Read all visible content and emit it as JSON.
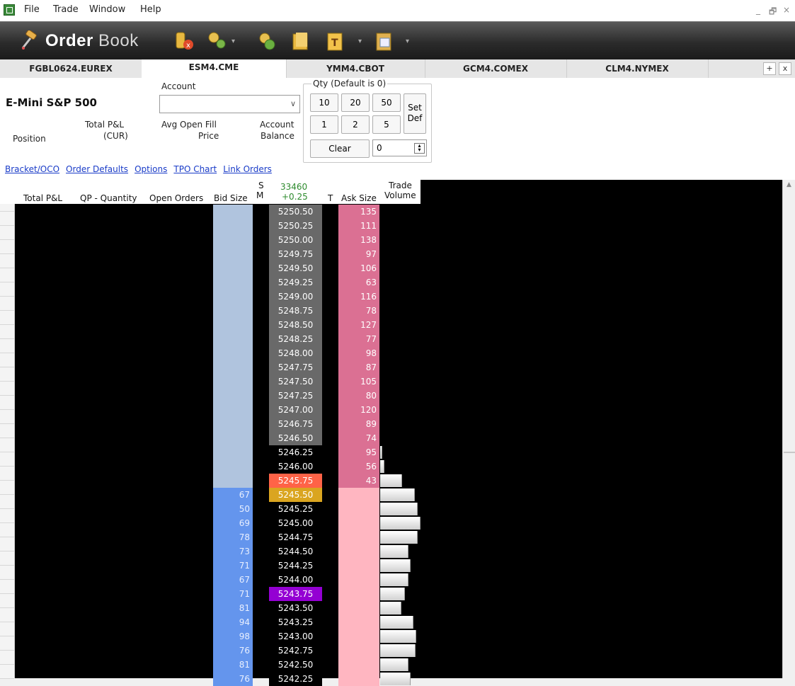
{
  "menubar": {
    "items": [
      "File",
      "Trade",
      "Window",
      "Help"
    ],
    "controls": {
      "minimize": "_",
      "restore": "🗗",
      "close": "×"
    }
  },
  "banner": {
    "logo_bold": "Order",
    "logo_light": "Book",
    "toolbar_icons": [
      "cancel-orders-icon",
      "gears-icon",
      "recycle-gears-icon",
      "folder-icon",
      "template-icon",
      "clipboard-icon"
    ]
  },
  "tabs": {
    "items": [
      {
        "label": "FGBL0624.EUREX",
        "active": false
      },
      {
        "label": "ESM4.CME",
        "active": true
      },
      {
        "label": "YMM4.CBOT",
        "active": false
      },
      {
        "label": "GCM4.COMEX",
        "active": false
      },
      {
        "label": "CLM4.NYMEX",
        "active": false
      }
    ],
    "add_label": "+",
    "close_label": "x"
  },
  "panel": {
    "instrument": "E-Mini S&P 500",
    "account_label": "Account",
    "account_value": "",
    "position_label": "Position",
    "total_pnl_label_1": "Total P&L",
    "total_pnl_label_2": "(CUR)",
    "avg_open_label_1": "Avg Open Fill",
    "avg_open_label_2": "Price",
    "acct_balance_label_1": "Account",
    "acct_balance_label_2": "Balance",
    "qty_legend": "Qty (Default is 0)",
    "qty_row1": [
      "10",
      "20",
      "50"
    ],
    "qty_row2": [
      "1",
      "2",
      "5"
    ],
    "set_def_label_1": "Set",
    "set_def_label_2": "Def",
    "clear_label": "Clear",
    "qty_value": "0"
  },
  "links": [
    "Bracket/OCO",
    "Order Defaults",
    "Options",
    "TPO Chart",
    "Link Orders"
  ],
  "ladder_header": {
    "total_pnl": "Total P&L",
    "qp_quantity": "QP - Quantity",
    "open_orders": "Open Orders",
    "bid_size": "Bid Size",
    "s": "S",
    "m": "M",
    "volume_top": "33460",
    "change": "+0.25",
    "t": "T",
    "ask_size": "Ask Size",
    "trade": "Trade",
    "volume": "Volume"
  },
  "colors": {
    "bid_light": "#b0c4de",
    "bid": "#6495ed",
    "ask": "#db7093",
    "ask_light": "#ffb6c1",
    "price_gray": "#696969",
    "last_trade": "#ff6347",
    "best_bid": "#daa520",
    "highlight": "#9400d3",
    "change_green": "#4cbb17"
  },
  "ladder": [
    {
      "price": "5250.50",
      "ask": "135",
      "bid": "",
      "vol": 0,
      "style": "gray"
    },
    {
      "price": "5250.25",
      "ask": "111",
      "bid": "",
      "vol": 0,
      "style": "gray"
    },
    {
      "price": "5250.00",
      "ask": "138",
      "bid": "",
      "vol": 0,
      "style": "gray"
    },
    {
      "price": "5249.75",
      "ask": "97",
      "bid": "",
      "vol": 0,
      "style": "gray"
    },
    {
      "price": "5249.50",
      "ask": "106",
      "bid": "",
      "vol": 0,
      "style": "gray"
    },
    {
      "price": "5249.25",
      "ask": "63",
      "bid": "",
      "vol": 0,
      "style": "gray"
    },
    {
      "price": "5249.00",
      "ask": "116",
      "bid": "",
      "vol": 0,
      "style": "gray"
    },
    {
      "price": "5248.75",
      "ask": "78",
      "bid": "",
      "vol": 0,
      "style": "gray"
    },
    {
      "price": "5248.50",
      "ask": "127",
      "bid": "",
      "vol": 0,
      "style": "gray"
    },
    {
      "price": "5248.25",
      "ask": "77",
      "bid": "",
      "vol": 0,
      "style": "gray"
    },
    {
      "price": "5248.00",
      "ask": "98",
      "bid": "",
      "vol": 0,
      "style": "gray"
    },
    {
      "price": "5247.75",
      "ask": "87",
      "bid": "",
      "vol": 0,
      "style": "gray"
    },
    {
      "price": "5247.50",
      "ask": "105",
      "bid": "",
      "vol": 0,
      "style": "gray"
    },
    {
      "price": "5247.25",
      "ask": "80",
      "bid": "",
      "vol": 0,
      "style": "gray"
    },
    {
      "price": "5247.00",
      "ask": "120",
      "bid": "",
      "vol": 0,
      "style": "gray"
    },
    {
      "price": "5246.75",
      "ask": "89",
      "bid": "",
      "vol": 0,
      "style": "gray"
    },
    {
      "price": "5246.50",
      "ask": "74",
      "bid": "",
      "vol": 0,
      "style": "gray"
    },
    {
      "price": "5246.25",
      "ask": "95",
      "bid": "",
      "vol": 0.04,
      "style": "black"
    },
    {
      "price": "5246.00",
      "ask": "56",
      "bid": "",
      "vol": 0.09,
      "style": "black"
    },
    {
      "price": "5245.75",
      "ask": "43",
      "bid": "",
      "vol": 0.5,
      "style": "last"
    },
    {
      "price": "5245.50",
      "ask": "",
      "bid": "67",
      "vol": 0.8,
      "style": "bestbid"
    },
    {
      "price": "5245.25",
      "ask": "",
      "bid": "50",
      "vol": 0.87,
      "style": "black"
    },
    {
      "price": "5245.00",
      "ask": "",
      "bid": "69",
      "vol": 0.93,
      "style": "black"
    },
    {
      "price": "5244.75",
      "ask": "",
      "bid": "78",
      "vol": 0.87,
      "style": "black"
    },
    {
      "price": "5244.50",
      "ask": "",
      "bid": "73",
      "vol": 0.65,
      "style": "black"
    },
    {
      "price": "5244.25",
      "ask": "",
      "bid": "71",
      "vol": 0.7,
      "style": "black"
    },
    {
      "price": "5244.00",
      "ask": "",
      "bid": "67",
      "vol": 0.65,
      "style": "black"
    },
    {
      "price": "5243.75",
      "ask": "",
      "bid": "71",
      "vol": 0.57,
      "style": "highlight"
    },
    {
      "price": "5243.50",
      "ask": "",
      "bid": "81",
      "vol": 0.48,
      "style": "black"
    },
    {
      "price": "5243.25",
      "ask": "",
      "bid": "94",
      "vol": 0.76,
      "style": "black"
    },
    {
      "price": "5243.00",
      "ask": "",
      "bid": "98",
      "vol": 0.83,
      "style": "black"
    },
    {
      "price": "5242.75",
      "ask": "",
      "bid": "76",
      "vol": 0.81,
      "style": "black"
    },
    {
      "price": "5242.50",
      "ask": "",
      "bid": "81",
      "vol": 0.65,
      "style": "black"
    },
    {
      "price": "5242.25",
      "ask": "",
      "bid": "76",
      "vol": 0.7,
      "style": "black"
    }
  ]
}
